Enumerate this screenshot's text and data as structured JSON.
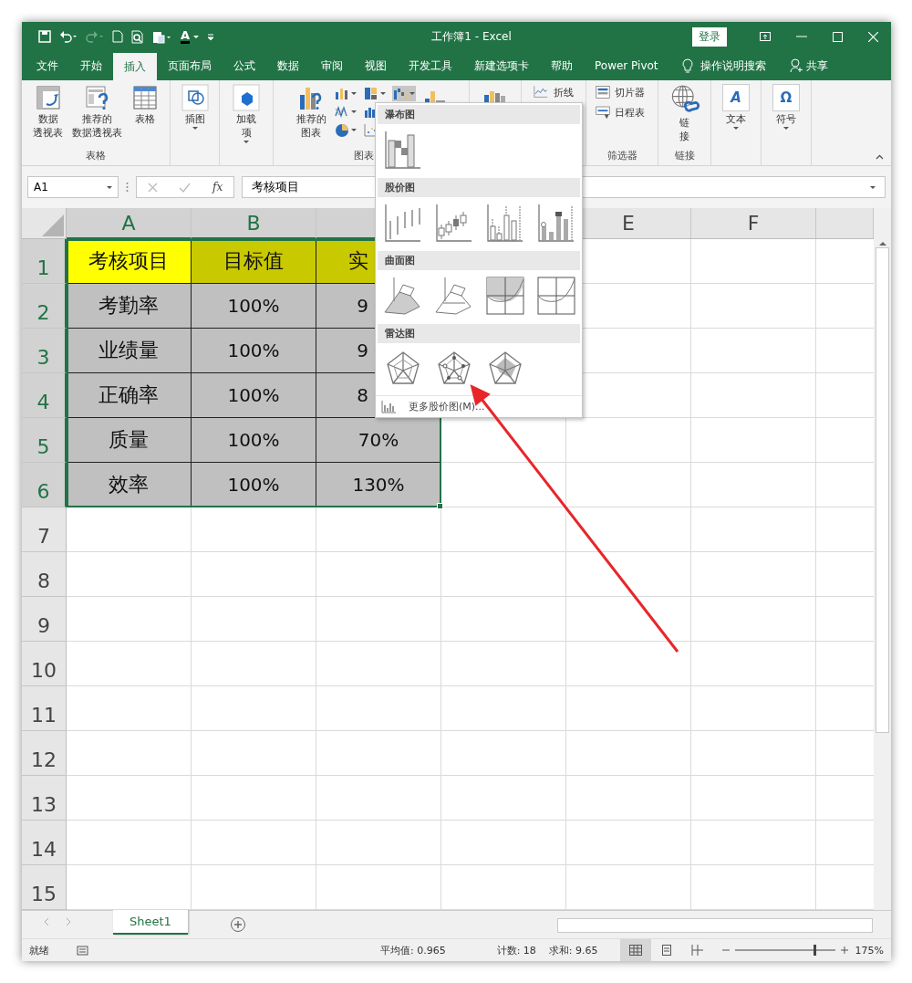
{
  "window": {
    "title": "工作簿1  -  Excel",
    "login": "登录"
  },
  "quick_access": [
    {
      "kind": "save"
    },
    {
      "kind": "undo"
    },
    {
      "kind": "redo",
      "disabled": true
    },
    {
      "kind": "new"
    },
    {
      "kind": "preview"
    },
    {
      "kind": "paste"
    },
    {
      "kind": "font_color",
      "glyph": "A"
    },
    {
      "kind": "customize"
    }
  ],
  "tabs": [
    {
      "label": "文件",
      "selected": false
    },
    {
      "label": "开始",
      "selected": false
    },
    {
      "label": "插入",
      "selected": true
    },
    {
      "label": "页面布局",
      "selected": false
    },
    {
      "label": "公式",
      "selected": false
    },
    {
      "label": "数据",
      "selected": false
    },
    {
      "label": "审阅",
      "selected": false
    },
    {
      "label": "视图",
      "selected": false
    },
    {
      "label": "开发工具",
      "selected": false
    },
    {
      "label": "新建选项卡",
      "selected": false
    },
    {
      "label": "帮助",
      "selected": false
    },
    {
      "label": "Power Pivot",
      "selected": false
    }
  ],
  "tell_me": "操作说明搜索",
  "share": "共享",
  "ribbon": {
    "groups": [
      {
        "label": "表格",
        "items": [
          {
            "kind": "pivot",
            "lines": [
              "数据",
              "透视表"
            ]
          },
          {
            "kind": "rec_pivot",
            "lines": [
              "推荐的",
              "数据透视表"
            ]
          },
          {
            "kind": "table",
            "label": "表格"
          }
        ]
      },
      {
        "items": [
          {
            "kind": "illustrations",
            "label": "插图",
            "caret": true
          }
        ]
      },
      {
        "items": [
          {
            "kind": "addins",
            "lines": [
              "加载",
              "项"
            ],
            "caret": true
          }
        ]
      },
      {
        "label": "图表",
        "items": [
          {
            "kind": "rec_chart",
            "lines": [
              "推荐的",
              "图表"
            ]
          },
          {
            "kind": "chart_grid"
          },
          {
            "kind": "pivot_chart"
          }
        ]
      },
      {
        "items": [
          {
            "kind": "map3d"
          }
        ]
      },
      {
        "items": [
          {
            "kind": "sparkline",
            "label": "折线"
          }
        ]
      },
      {
        "label": "筛选器",
        "items": [
          {
            "kind": "slicer",
            "label": "切片器"
          },
          {
            "kind": "timeline",
            "label": "日程表"
          }
        ]
      },
      {
        "label": "链接",
        "items": [
          {
            "kind": "link",
            "lines": [
              "链",
              "接"
            ]
          }
        ]
      },
      {
        "items": [
          {
            "kind": "text",
            "label": "文本",
            "glyph": "A",
            "caret": true
          }
        ]
      },
      {
        "items": [
          {
            "kind": "symbol",
            "label": "符号",
            "glyph": "Ω",
            "caret": true
          }
        ]
      }
    ]
  },
  "formula_bar": {
    "name_box": "A1",
    "fx": "fx",
    "value": "考核项目"
  },
  "columns": [
    {
      "label": "A",
      "selected": true
    },
    {
      "label": "B",
      "selected": true
    },
    {
      "selected": true
    },
    {},
    {
      "label": "E",
      "selected": false
    },
    {
      "label": "F",
      "selected": false
    },
    {
      "selected": false
    }
  ],
  "rows": [
    {
      "label": "1",
      "selected": true,
      "cells": [
        {
          "text": "考核项目",
          "color": "#ffff00"
        },
        {
          "text": "目标值",
          "color": "#c9c900"
        },
        {
          "text": "实",
          "color": "#c9c900",
          "cut": true
        }
      ]
    },
    {
      "label": "2",
      "selected": true,
      "cells": [
        {
          "text": "考勤率",
          "color": "#c0c0c0"
        },
        {
          "text": "100%",
          "color": "#c0c0c0"
        },
        {
          "text": "9",
          "color": "#c0c0c0",
          "cut": true
        }
      ]
    },
    {
      "label": "3",
      "selected": true,
      "cells": [
        {
          "text": "业绩量",
          "color": "#c0c0c0"
        },
        {
          "text": "100%",
          "color": "#c0c0c0"
        },
        {
          "text": "9",
          "color": "#c0c0c0",
          "cut": true
        }
      ]
    },
    {
      "label": "4",
      "selected": true,
      "cells": [
        {
          "text": "正确率",
          "color": "#c0c0c0"
        },
        {
          "text": "100%",
          "color": "#c0c0c0"
        },
        {
          "text": "8",
          "color": "#c0c0c0",
          "cut": true
        }
      ]
    },
    {
      "label": "5",
      "selected": true,
      "cells": [
        {
          "text": "质量",
          "color": "#c0c0c0"
        },
        {
          "text": "100%",
          "color": "#c0c0c0"
        },
        {
          "text": "70%",
          "color": "#c0c0c0"
        }
      ]
    },
    {
      "label": "6",
      "selected": true,
      "cells": [
        {
          "text": "效率",
          "color": "#c0c0c0"
        },
        {
          "text": "100%",
          "color": "#c0c0c0"
        },
        {
          "text": "130%",
          "color": "#c0c0c0"
        }
      ]
    },
    {
      "label": "7",
      "selected": false
    },
    {
      "label": "8",
      "selected": false
    },
    {
      "label": "9",
      "selected": false
    },
    {
      "label": "10",
      "selected": false
    },
    {
      "label": "11",
      "selected": false
    },
    {
      "label": "12",
      "selected": false
    },
    {
      "label": "13",
      "selected": false
    },
    {
      "label": "14",
      "selected": false
    },
    {
      "label": "15",
      "selected": false
    }
  ],
  "chart_menu": {
    "sections": [
      {
        "title": "瀑布图",
        "options": [
          {
            "kind": "waterfall"
          }
        ]
      },
      {
        "title": "股价图",
        "options": [
          {
            "kind": "hlc"
          },
          {
            "kind": "ohlc"
          },
          {
            "kind": "vhlc"
          },
          {
            "kind": "vohlc"
          }
        ]
      },
      {
        "title": "曲面图",
        "options": [
          {
            "kind": "surface3d"
          },
          {
            "kind": "wire3d"
          },
          {
            "kind": "contour"
          },
          {
            "kind": "wirecontour"
          }
        ]
      },
      {
        "title": "雷达图",
        "options": [
          {
            "kind": "radar"
          },
          {
            "kind": "radar_markers"
          },
          {
            "kind": "radar_filled"
          }
        ]
      }
    ],
    "more": "更多股价图(M)..."
  },
  "sheet_tabs": [
    {
      "label": "Sheet1",
      "selected": true
    }
  ],
  "status_bar": {
    "ready": "就绪",
    "average": "平均值: 0.965",
    "count": "计数: 18",
    "sum": "求和: 9.65",
    "views": [
      {
        "kind": "normal",
        "selected": true
      },
      {
        "kind": "layout",
        "selected": false
      },
      {
        "kind": "pagebreak",
        "selected": false
      }
    ],
    "zoom": {
      "level": 0.8,
      "label": "175%"
    }
  }
}
